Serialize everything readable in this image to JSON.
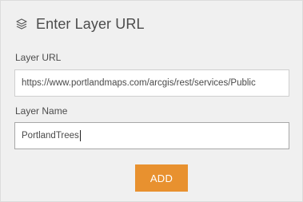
{
  "header": {
    "icon": "layers-icon",
    "title": "Enter Layer URL"
  },
  "form": {
    "url_label": "Layer URL",
    "url_value": "https://www.portlandmaps.com/arcgis/rest/services/Public",
    "name_label": "Layer Name",
    "name_value": "PortlandTrees"
  },
  "actions": {
    "add_label": "ADD"
  },
  "colors": {
    "accent": "#e8912f",
    "panel_bg": "#f0f0f0"
  }
}
